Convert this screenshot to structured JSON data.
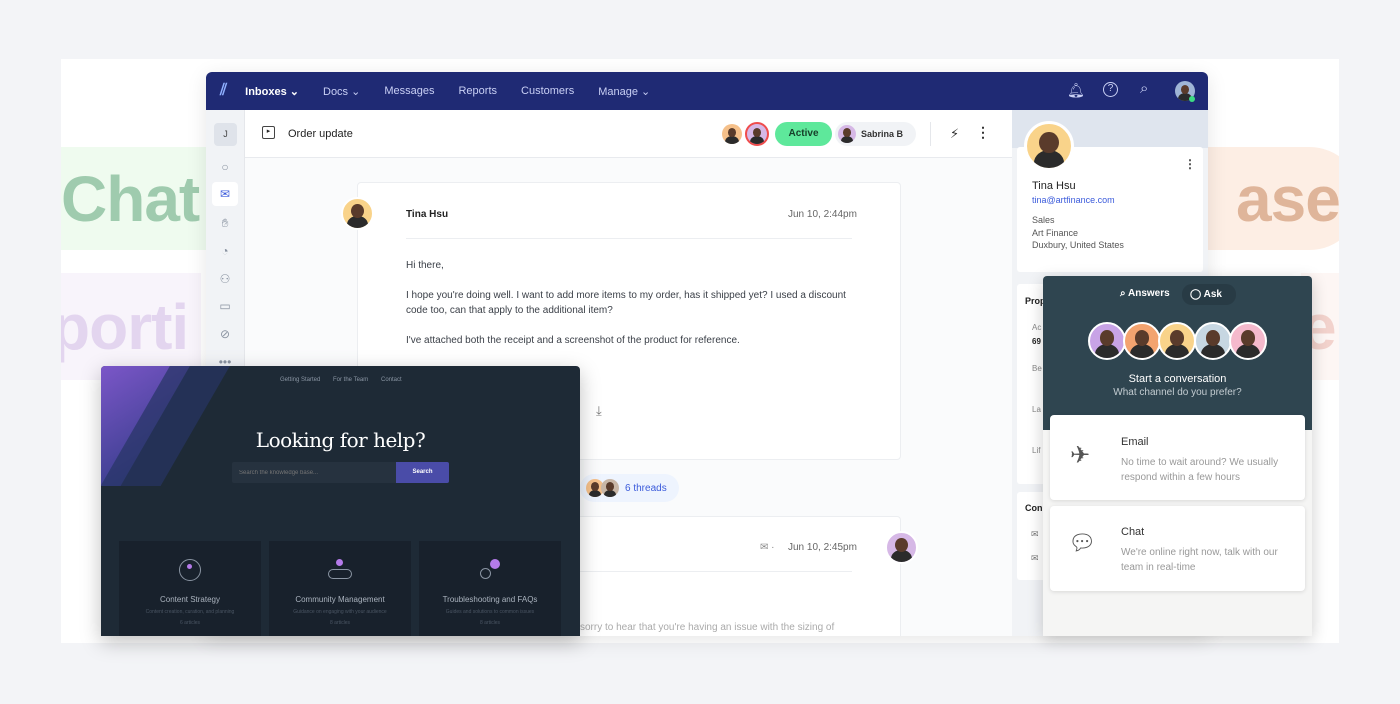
{
  "background_words": [
    "Chat",
    "porti",
    "ase",
    "e"
  ],
  "nav": {
    "items": [
      {
        "label": "Inboxes",
        "chevron": true
      },
      {
        "label": "Docs",
        "chevron": true
      },
      {
        "label": "Messages"
      },
      {
        "label": "Reports"
      },
      {
        "label": "Customers"
      },
      {
        "label": "Manage",
        "chevron": true
      }
    ],
    "icons": [
      "bell-icon",
      "help-icon",
      "search-icon",
      "avatar"
    ]
  },
  "sidebar": {
    "initial": "J",
    "icons": [
      "chat-icon",
      "inbox-icon",
      "hand-icon",
      "chart-icon",
      "user-icon",
      "archive-icon",
      "blocked-icon",
      "more-icon"
    ]
  },
  "header": {
    "title": "Order update",
    "status": "Active",
    "assignee": "Sabrina B"
  },
  "message": {
    "author": "Tina Hsu",
    "time": "Jun 10, 2:44pm",
    "greeting": "Hi there,",
    "para1": "I hope you're doing well. I want to add more items to my order, has it shipped yet? I used a discount code too, can that apply to the additional item?",
    "para2": "I've attached both the receipt and a screenshot of the product for reference."
  },
  "threads": "6 threads",
  "reply": {
    "time": "Jun 10, 2:45pm",
    "snippet": "sorry to hear that you're having an issue with the sizing of"
  },
  "profile": {
    "name": "Tina Hsu",
    "email": "tina@artfinance.com",
    "role": "Sales",
    "company": "Art Finance",
    "location": "Duxbury, United States",
    "section1": "Prop",
    "section2": "Con",
    "rows": [
      "Ac",
      "69",
      "Be",
      "La",
      "Lif"
    ]
  },
  "widget": {
    "tab_answers": "Answers",
    "tab_ask": "Ask",
    "title": "Start a conversation",
    "subtitle": "What channel do you prefer?",
    "options": [
      {
        "title": "Email",
        "desc": "No time to wait around? We usually respond within a few hours"
      },
      {
        "title": "Chat",
        "desc": "We're online right now, talk with our team in real-time"
      }
    ]
  },
  "help": {
    "nav": [
      "Getting Started",
      "For the Team",
      "Contact"
    ],
    "title": "Looking for help?",
    "search_placeholder": "Search the knowledge base...",
    "search_button": "Search",
    "cards": [
      {
        "title": "Content Strategy",
        "desc": "Content creation, curation, and planning",
        "count": "6 articles"
      },
      {
        "title": "Community Management",
        "desc": "Guidance on engaging with your audience",
        "count": "8 articles"
      },
      {
        "title": "Troubleshooting and FAQs",
        "desc": "Guides and solutions to common issues",
        "count": "8 articles"
      }
    ]
  },
  "colors": {
    "nav": "#1f2a74",
    "active": "#5ee89b",
    "link": "#3b5bdb",
    "widget": "#2f4550",
    "help_bg": "#1e2a36",
    "help_button": "#4a4ca8",
    "accent_purple": "#b57bea"
  }
}
